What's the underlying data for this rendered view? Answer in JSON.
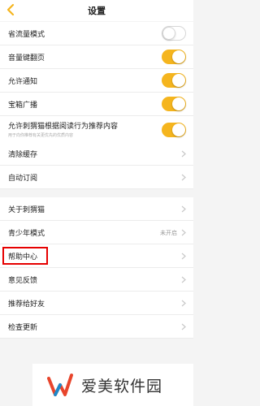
{
  "header": {
    "title": "设置",
    "back_icon": "chevron-left-icon",
    "accent_color": "#f5b51e"
  },
  "toggles": [
    {
      "label": "省流量模式",
      "on": false
    },
    {
      "label": "音量键翻页",
      "on": true
    },
    {
      "label": "允许通知",
      "on": true
    },
    {
      "label": "宝箱广播",
      "on": true
    },
    {
      "label": "允许刺猬猫根据阅读行为推荐内容",
      "sub": "用于向你推荐有关更优先的优质内容",
      "on": true
    }
  ],
  "group1": [
    {
      "label": "清除缓存"
    },
    {
      "label": "自动订阅"
    }
  ],
  "group2": [
    {
      "label": "关于刺猬猫"
    },
    {
      "label": "青少年模式",
      "value": "未开启"
    },
    {
      "label": "帮助中心",
      "highlighted": true
    },
    {
      "label": "意见反馈"
    },
    {
      "label": "推荐给好友"
    },
    {
      "label": "检查更新"
    }
  ],
  "watermark": {
    "text": "爱美软件园"
  }
}
